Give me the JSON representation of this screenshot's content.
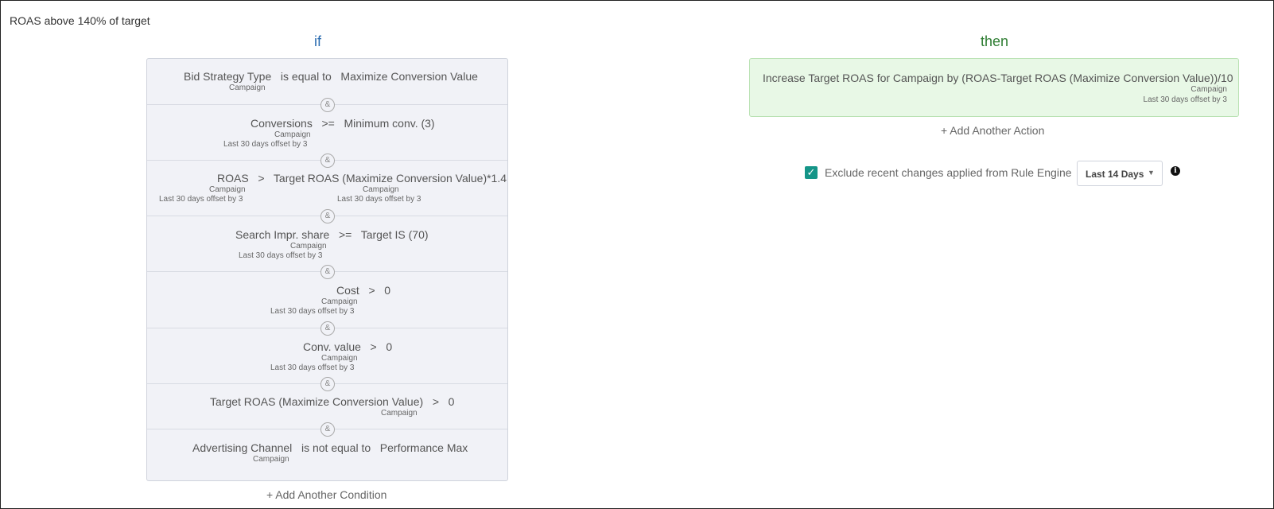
{
  "rule": {
    "title": "ROAS above 140% of target"
  },
  "headers": {
    "if": "if",
    "then": "then"
  },
  "conditions": [
    {
      "line": "Bid Strategy Type   is equal to   Maximize Conversion Value",
      "sub1": "Campaign",
      "sub2": ""
    },
    {
      "line": "Conversions   >=   Minimum conv. (3)",
      "sub1": "Campaign",
      "sub2": "Last 30 days offset by 3"
    },
    {
      "line": "ROAS   >   Target ROAS (Maximize Conversion Value)*1.4",
      "sub1": "Campaign",
      "sub2": "Last 30 days offset by 3",
      "sub3": "Campaign",
      "sub4": "Last 30 days offset by 3"
    },
    {
      "line": "Search Impr. share   >=   Target IS (70)",
      "sub1": "Campaign",
      "sub2": "Last 30 days offset by 3"
    },
    {
      "line": "Cost   >   0",
      "sub1": "Campaign",
      "sub2": "Last 30 days offset by 3"
    },
    {
      "line": "Conv. value   >   0",
      "sub1": "Campaign",
      "sub2": "Last 30 days offset by 3"
    },
    {
      "line": "Target ROAS (Maximize Conversion Value)   >   0",
      "sub1": "Campaign",
      "sub2": ""
    },
    {
      "line": "Advertising Channel   is not equal to   Performance Max",
      "sub1": "Campaign",
      "sub2": ""
    }
  ],
  "amp_symbol": "&",
  "add_condition": "+ Add Another Condition",
  "action": {
    "line": "Increase Target ROAS for Campaign by (ROAS-Target ROAS (Maximize Conversion Value))/10",
    "sub1": "Campaign",
    "sub2": "Last 30 days offset by 3"
  },
  "add_action": "+ Add Another Action",
  "exclude": {
    "checked": true,
    "check_glyph": "✓",
    "label": "Exclude recent changes applied from Rule Engine",
    "dropdown_value": "Last 14 Days",
    "caret": "▼",
    "info_glyph": "i"
  },
  "colors": {
    "if": "#2b6cb0",
    "then": "#2e7d32",
    "checkbox": "#159588",
    "action_bg": "#e8f8e6",
    "cond_bg": "#f1f2f7"
  }
}
